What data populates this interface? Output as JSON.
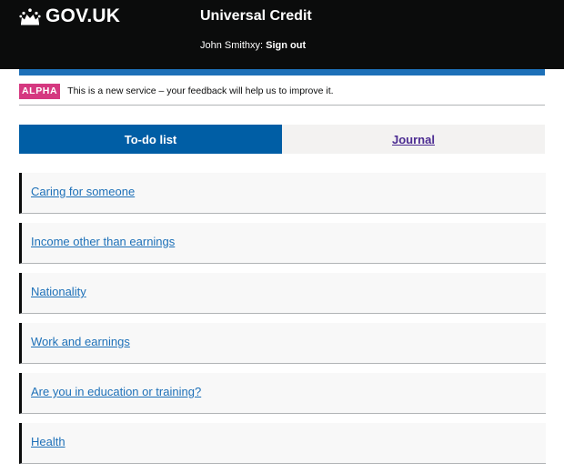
{
  "header": {
    "logo_text": "GOV.UK",
    "logo_icon": "crown-icon",
    "service_name": "Universal Credit",
    "user_name": "John Smithxy:",
    "sign_out_label": "Sign out"
  },
  "phase_banner": {
    "tag": "ALPHA",
    "text": "This is a new service – your feedback will help us to improve it."
  },
  "tabs": [
    {
      "label": "To-do list",
      "selected": true
    },
    {
      "label": "Journal",
      "selected": false
    }
  ],
  "tasks": [
    {
      "label": "Caring for someone"
    },
    {
      "label": "Income other than earnings"
    },
    {
      "label": "Nationality"
    },
    {
      "label": "Work and earnings"
    },
    {
      "label": "Are you in education or training?"
    },
    {
      "label": "Health"
    }
  ],
  "colors": {
    "header_bg": "#0b0c0c",
    "brand_blue": "#1d70b8",
    "tab_active": "#005ea5",
    "alpha_tag": "#d53880",
    "link": "#1d70b8",
    "visited_link": "#4c2c92"
  }
}
